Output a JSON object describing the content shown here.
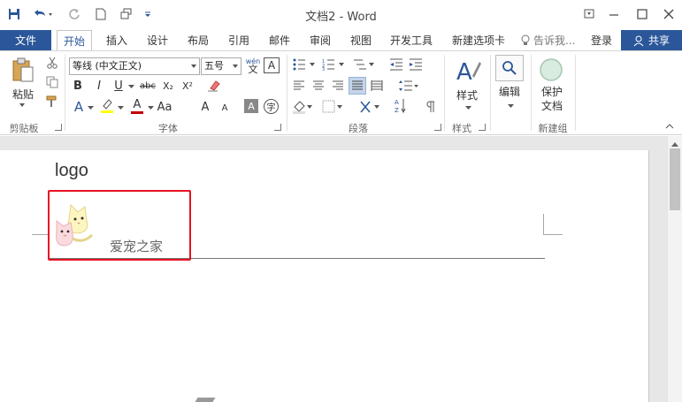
{
  "window": {
    "title": "文档2 - Word"
  },
  "quick_access": {
    "save_icon": "save-icon",
    "undo_icon": "undo-icon",
    "redo_icon": "redo-icon",
    "new_icon": "new-doc-icon",
    "touch_icon": "touch-mode-icon"
  },
  "tabs": {
    "file": "文件",
    "items": [
      "开始",
      "插入",
      "设计",
      "布局",
      "引用",
      "邮件",
      "审阅",
      "视图",
      "开发工具",
      "新建选项卡"
    ],
    "active": "开始",
    "tell_me": "告诉我...",
    "login": "登录",
    "share": "共享"
  },
  "ribbon": {
    "clipboard": {
      "paste": "粘贴",
      "label": "剪贴板"
    },
    "font": {
      "name": "等线 (中文正文)",
      "size": "五号",
      "wen": "wén",
      "label": "字体",
      "bold": "B",
      "italic": "I",
      "underline": "U",
      "strike": "abc",
      "sub": "X₂",
      "sup": "X²",
      "grow": "A",
      "shrink": "A",
      "clear": "A",
      "phonetic": "A",
      "char_border": "A",
      "enclose": "字"
    },
    "paragraph": {
      "label": "段落"
    },
    "styles": {
      "button": "样式",
      "label": "样式"
    },
    "editing": {
      "button": "编辑"
    },
    "newgroup": {
      "button_line1": "保护",
      "button_line2": "文档",
      "label": "新建组"
    }
  },
  "document": {
    "header_text": "logo",
    "logo_caption": "爱宠之家"
  },
  "colors": {
    "brand": "#2b579a",
    "highlight": "#e81123",
    "font_red": "#c00000",
    "highlight_yellow": "#ffff00"
  }
}
